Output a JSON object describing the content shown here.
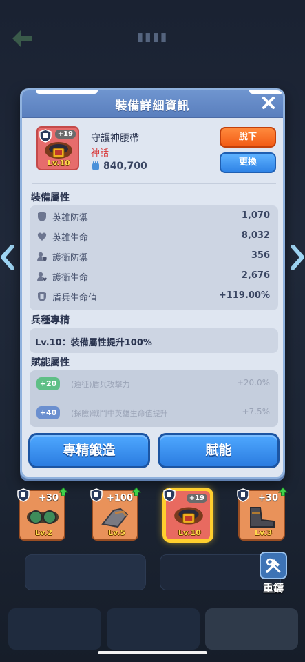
{
  "modal": {
    "title": "裝備詳細資訊",
    "item": {
      "name": "守護神腰帶",
      "rarity": "神話",
      "power": "840,700",
      "enhance": "+19",
      "level": "Lv.10"
    },
    "buttons": {
      "unequip": "脫下",
      "replace": "更換"
    },
    "attributes_title": "裝備屬性",
    "attributes": [
      {
        "icon": "shield-icon",
        "label": "英雄防禦",
        "value": "1,070"
      },
      {
        "icon": "heart-icon",
        "label": "英雄生命",
        "value": "8,032"
      },
      {
        "icon": "guard-defense-icon",
        "label": "護衛防禦",
        "value": "356"
      },
      {
        "icon": "guard-health-icon",
        "label": "護衛生命",
        "value": "2,676"
      },
      {
        "icon": "shield-soldier-icon",
        "label": "盾兵生命值",
        "value": "+119.00%"
      }
    ],
    "specialization_title": "兵種專精",
    "specialization_text": "Lv.10：裝備屬性提升100%",
    "talent_title": "賦能屬性",
    "talents": [
      {
        "badge": "+20",
        "color": "#5fbf86",
        "label": "(遠征)盾兵攻擊力",
        "value": "+20.0%"
      },
      {
        "badge": "+40",
        "color": "#6b8fcf",
        "label": "(探險)戰鬥中英雄生命值提升",
        "value": "+7.5%"
      }
    ],
    "forge_button": "專精鍛造",
    "empower_button": "賦能"
  },
  "slots": [
    {
      "enhance": "+30",
      "level": "Lv.2",
      "icon": "goggles-icon",
      "selected": false
    },
    {
      "enhance": "+100",
      "level": "Lv.5",
      "icon": "gauntlet-icon",
      "selected": false
    },
    {
      "enhance": "+19",
      "level": "Lv.10",
      "icon": "belt-icon",
      "selected": true
    },
    {
      "enhance": "+30",
      "level": "Lv.3",
      "icon": "boots-icon",
      "selected": false
    }
  ],
  "reforge_label": "重鑄",
  "colors": {
    "header": "#5a7fbe",
    "unequip_button": "#f25b15",
    "blue_button": "#2f83e6",
    "rarity_mythic": "#d83434",
    "selected_glow": "#ffcf2e"
  }
}
